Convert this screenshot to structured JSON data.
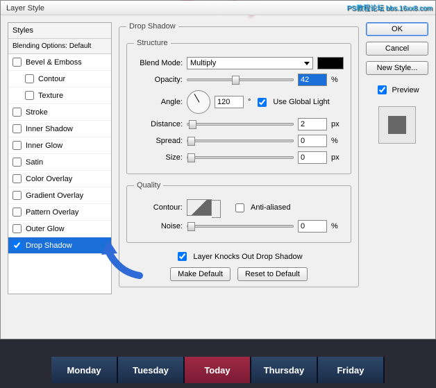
{
  "window_title": "Layer Style",
  "watermark": "PS教程论坛\nbbs.16xx8.com",
  "bg_behind": "Tuesday",
  "sidebar": {
    "head": "Styles",
    "sub": "Blending Options: Default",
    "items": [
      {
        "label": "Bevel & Emboss",
        "checked": false,
        "indent": false
      },
      {
        "label": "Contour",
        "checked": false,
        "indent": true
      },
      {
        "label": "Texture",
        "checked": false,
        "indent": true
      },
      {
        "label": "Stroke",
        "checked": false,
        "indent": false
      },
      {
        "label": "Inner Shadow",
        "checked": false,
        "indent": false
      },
      {
        "label": "Inner Glow",
        "checked": false,
        "indent": false
      },
      {
        "label": "Satin",
        "checked": false,
        "indent": false
      },
      {
        "label": "Color Overlay",
        "checked": false,
        "indent": false
      },
      {
        "label": "Gradient Overlay",
        "checked": false,
        "indent": false
      },
      {
        "label": "Pattern Overlay",
        "checked": false,
        "indent": false
      },
      {
        "label": "Outer Glow",
        "checked": false,
        "indent": false
      },
      {
        "label": "Drop Shadow",
        "checked": true,
        "indent": false,
        "active": true
      }
    ]
  },
  "panel": {
    "title": "Drop Shadow",
    "structure": {
      "legend": "Structure",
      "blend_mode_label": "Blend Mode:",
      "blend_mode_value": "Multiply",
      "opacity_label": "Opacity:",
      "opacity_value": "42",
      "opacity_unit": "%",
      "angle_label": "Angle:",
      "angle_value": "120",
      "angle_unit": "°",
      "global_light_label": "Use Global Light",
      "global_light_checked": true,
      "distance_label": "Distance:",
      "distance_value": "2",
      "distance_unit": "px",
      "spread_label": "Spread:",
      "spread_value": "0",
      "spread_unit": "%",
      "size_label": "Size:",
      "size_value": "0",
      "size_unit": "px"
    },
    "quality": {
      "legend": "Quality",
      "contour_label": "Contour:",
      "antialiased_label": "Anti-aliased",
      "antialiased_checked": false,
      "noise_label": "Noise:",
      "noise_value": "0",
      "noise_unit": "%"
    },
    "knockout_label": "Layer Knocks Out Drop Shadow",
    "knockout_checked": true,
    "make_default": "Make Default",
    "reset_default": "Reset to Default"
  },
  "buttons": {
    "ok": "OK",
    "cancel": "Cancel",
    "new_style": "New Style...",
    "preview": "Preview",
    "preview_checked": true
  },
  "tabs": [
    "Monday",
    "Tuesday",
    "Today",
    "Thursday",
    "Friday"
  ]
}
